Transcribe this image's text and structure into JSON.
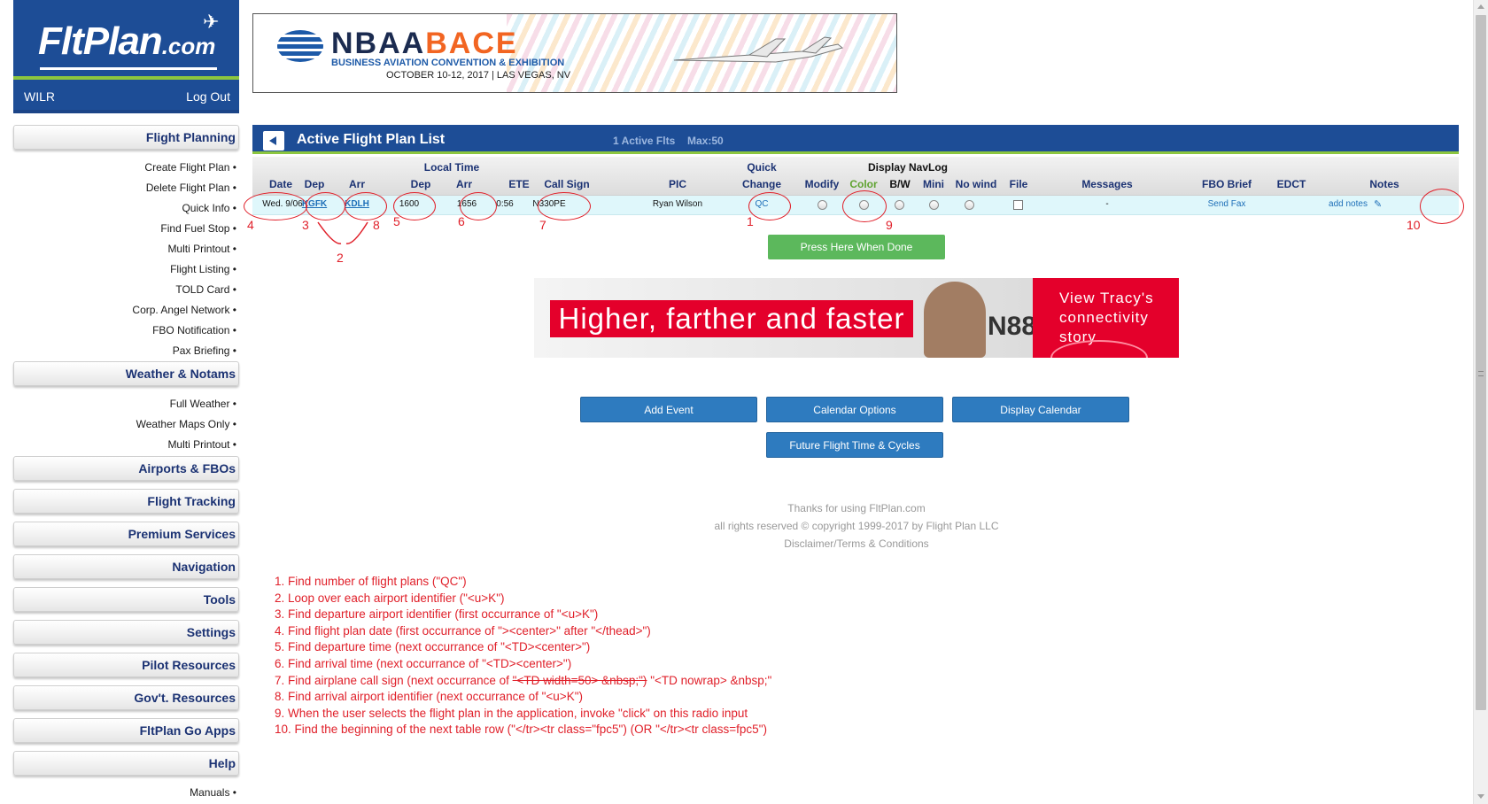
{
  "logo": {
    "text_main": "FltPlan",
    "text_suffix": ".com"
  },
  "account": {
    "user": "WILR",
    "logout": "Log Out"
  },
  "nav": {
    "flight_planning": "Flight Planning",
    "flight_planning_items": [
      "Create Flight Plan •",
      "Delete Flight Plan •",
      "Quick Info •",
      "Find Fuel Stop •",
      "Multi Printout •",
      "Flight Listing •",
      "TOLD Card •",
      "Corp. Angel Network •",
      "FBO Notification •",
      "Pax Briefing •"
    ],
    "weather": "Weather & Notams",
    "weather_items": [
      "Full Weather •",
      "Weather Maps Only •",
      "Multi Printout •"
    ],
    "airports": "Airports & FBOs",
    "tracking": "Flight Tracking",
    "premium": "Premium Services",
    "navigation": "Navigation",
    "tools": "Tools",
    "settings": "Settings",
    "pilot_resources": "Pilot Resources",
    "govt_resources": "Gov't. Resources",
    "go_apps": "FltPlan Go Apps",
    "help": "Help",
    "help_items": [
      "Manuals •"
    ]
  },
  "top_banner": {
    "brand_left": "NBAA",
    "brand_right": "BACE",
    "subtitle": "BUSINESS AVIATION CONVENTION & EXHIBITION",
    "date": "OCTOBER 10-12, 2017  |  LAS VEGAS, NV"
  },
  "panel": {
    "title": "Active Flight Plan List",
    "active_count": "1 Active Flts",
    "max": "Max:50"
  },
  "table": {
    "headers": {
      "date": "Date",
      "local_time": "Local Time",
      "dep": "Dep",
      "arr": "Arr",
      "dep_time": "Dep",
      "arr_time": "Arr",
      "ete": "ETE",
      "call_sign": "Call Sign",
      "pic": "PIC",
      "quick": "Quick",
      "change": "Change",
      "modify": "Modify",
      "display_navlog": "Display NavLog",
      "color": "Color",
      "bw": "B/W",
      "mini": "Mini",
      "no_wind": "No wind",
      "file": "File",
      "messages": "Messages",
      "fbo_brief": "FBO Brief",
      "edct": "EDCT",
      "notes": "Notes"
    },
    "row": {
      "date": "Wed. 9/06",
      "dep": "KGFK",
      "arr": "KDLH",
      "dep_time": "1600",
      "arr_time": "1656",
      "ete": "0:56",
      "call_sign": "N330PE",
      "pic": "Ryan Wilson",
      "quick_change": "QC",
      "messages": "-",
      "fbo_brief": "Send Fax",
      "edct": "",
      "notes": "add notes"
    }
  },
  "buttons": {
    "done": "Press Here When Done",
    "add_event": "Add Event",
    "calendar_options": "Calendar Options",
    "display_calendar": "Display Calendar",
    "future_flight": "Future Flight Time & Cycles"
  },
  "ad_banner": {
    "headline": "Higher, farther and faster",
    "tail_number": "N88",
    "cta_line1": "View Tracy's",
    "cta_line2": "connectivity",
    "cta_line3": "story"
  },
  "footer": {
    "thanks": "Thanks for using FltPlan.com",
    "copyright": "all rights reserved © copyright 1999-2017 by Flight Plan LLC",
    "disclaimer": "Disclaimer/Terms & Conditions"
  },
  "annotations": {
    "markers": [
      "1",
      "2",
      "3",
      "4",
      "5",
      "6",
      "7",
      "8",
      "9",
      "10"
    ],
    "notes": [
      "1. Find number of flight plans (\"QC\")",
      "2. Loop over each airport identifier (\"<u>K\")",
      "3. Find departure airport identifier (first occurrance of \"<u>K\")",
      "4. Find flight plan date (first occurrance of \"><center>\" after \"</thead>\")",
      "5. Find departure time (next occurrance of \"<TD><center>\")",
      "6. Find arrival time (next occurrance of \"<TD><center>\")",
      "8. Find arrival airport identifier (next occurrance of \"<u>K\")",
      "9. When the user selects the flight plan in the application, invoke \"click\" on this radio input",
      "10. Find the beginning of the next table row (\"</tr><tr class=\"fpc5\") (OR \"</tr><tr class=fpc5\")"
    ],
    "note7_prefix": "7. Find airplane call sign (next occurrance of ",
    "note7_struck": "\"<TD width=50> &nbsp;\")",
    "note7_suffix": "  \"<TD nowrap> &nbsp;\""
  },
  "colors": {
    "brand_blue": "#1d4d96",
    "accent_green": "#8cc63f",
    "annotation_red": "#e0202a",
    "row_highlight": "#dff7fb"
  }
}
